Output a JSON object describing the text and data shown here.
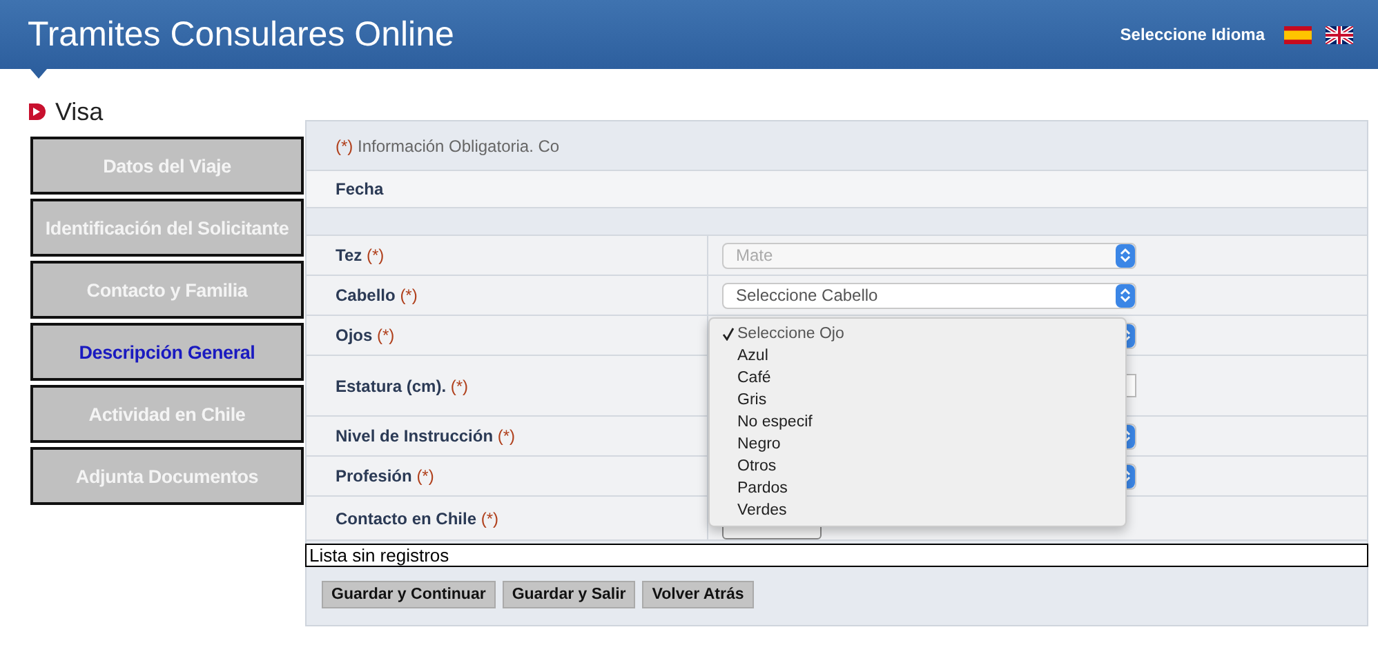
{
  "header": {
    "title": "Tramites Consulares Online",
    "language_label": "Seleccione Idioma"
  },
  "page_title": "Visa",
  "nav": [
    {
      "label": "Datos del Viaje",
      "selected": false
    },
    {
      "label": "Identificación del Solicitante",
      "selected": false
    },
    {
      "label": "Contacto y Familia",
      "selected": false
    },
    {
      "label": "Descripción General",
      "selected": true
    },
    {
      "label": "Actividad en Chile",
      "selected": false
    },
    {
      "label": "Adjunta Documentos",
      "selected": false
    }
  ],
  "notice": {
    "mark": "(*)",
    "text": "Información Obligatoria. Co"
  },
  "date_label": "Fecha",
  "fields": [
    {
      "kind": "select",
      "label": "Tez",
      "required": "(*)",
      "value": "Mate",
      "disabled": true
    },
    {
      "kind": "select",
      "label": "Cabello",
      "required": "(*)",
      "value": "Seleccione Cabello",
      "disabled": false
    },
    {
      "kind": "select",
      "label": "Ojos",
      "required": "(*)"
    },
    {
      "kind": "input",
      "label": "Estatura (cm).",
      "required": "(*)"
    },
    {
      "kind": "select",
      "label": "Nivel de Instrucción",
      "required": "(*)"
    },
    {
      "kind": "select",
      "label": "Profesión",
      "required": "(*)"
    },
    {
      "kind": "button",
      "label": "Contacto en Chile",
      "required": "(*)"
    }
  ],
  "dropdown": {
    "options": [
      {
        "label": "Seleccione Ojo",
        "selected": true
      },
      {
        "label": "Azul",
        "selected": false
      },
      {
        "label": "Café",
        "selected": false
      },
      {
        "label": "Gris",
        "selected": false
      },
      {
        "label": "No especif",
        "selected": false
      },
      {
        "label": "Negro",
        "selected": false
      },
      {
        "label": "Otros",
        "selected": false
      },
      {
        "label": "Pardos",
        "selected": false
      },
      {
        "label": "Verdes",
        "selected": false
      }
    ]
  },
  "list_status": "Lista sin registros",
  "buttons": [
    "Guardar y Continuar",
    "Guardar y Salir",
    "Volver Atrás"
  ]
}
